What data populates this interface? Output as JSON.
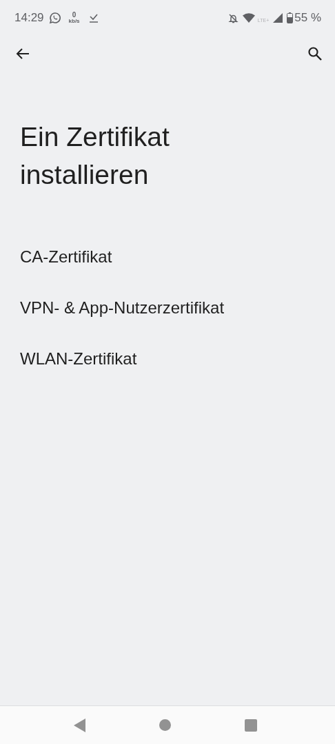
{
  "status_bar": {
    "time": "14:29",
    "speed_value": "0",
    "speed_unit": "kb/s",
    "network": "LTE+",
    "battery": "55 %"
  },
  "title": "Ein Zertifikat installieren",
  "items": [
    {
      "label": "CA-Zertifikat"
    },
    {
      "label": "VPN- & App-Nutzerzertifikat"
    },
    {
      "label": "WLAN-Zertifikat"
    }
  ]
}
